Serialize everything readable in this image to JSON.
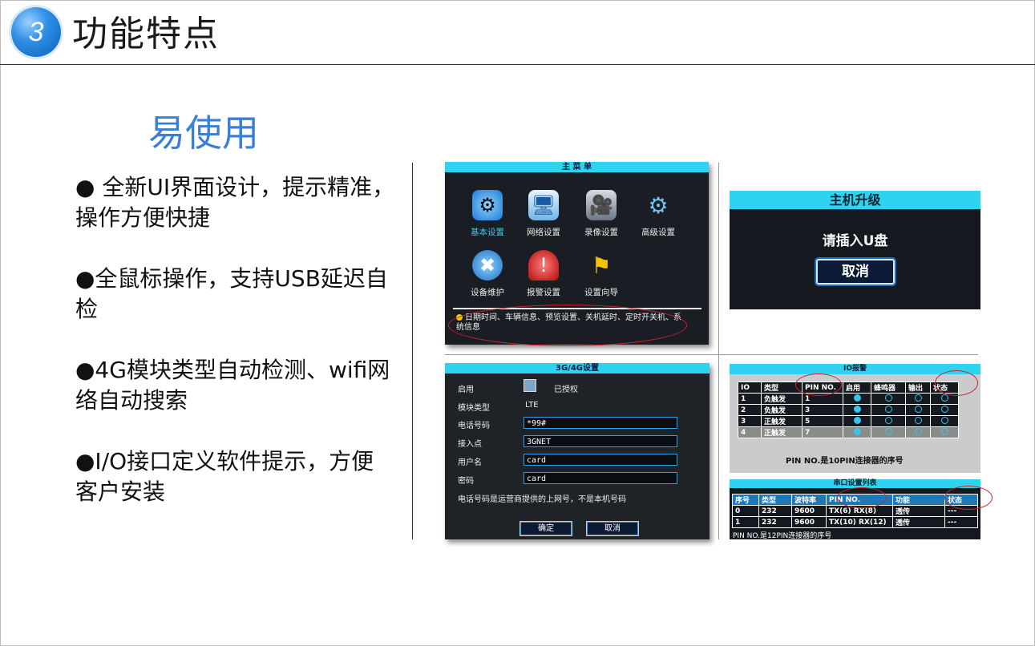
{
  "header": {
    "badge_number": "3",
    "title": "功能特点"
  },
  "subtitle": "易使用",
  "bullets": [
    "● 全新UI界面设计，提示精准，操作方便快捷",
    "●全鼠标操作，支持USB延迟自检",
    "●4G模块类型自动检测、wifi网络自动搜索",
    "●I/O接口定义软件提示，方便客户安装"
  ],
  "main_menu": {
    "title": "主 菜 单",
    "items": [
      {
        "label": "基本设置",
        "icon": "gear-icon"
      },
      {
        "label": "网络设置",
        "icon": "network-icon"
      },
      {
        "label": "录像设置",
        "icon": "camera-icon"
      },
      {
        "label": "高级设置",
        "icon": "gears-icon"
      },
      {
        "label": "设备维护",
        "icon": "tools-icon"
      },
      {
        "label": "报警设置",
        "icon": "alarm-icon"
      },
      {
        "label": "设置向导",
        "icon": "wizard-icon"
      }
    ],
    "description": "日期时间、车辆信息、预览设置、关机延时、定时开关机、系统信息"
  },
  "upgrade": {
    "title": "主机升级",
    "message": "请插入U盘",
    "cancel_label": "取消"
  },
  "net_settings": {
    "title": "3G/4G设置",
    "enable_label": "启用",
    "authorized_text": "已授权",
    "module_type_label": "模块类型",
    "module_type_value": "LTE",
    "phone_label": "电话号码",
    "phone_value": "*99#",
    "apn_label": "接入点",
    "apn_value": "3GNET",
    "user_label": "用户名",
    "user_value": "card",
    "password_label": "密码",
    "password_value": "card",
    "note": "电话号码是运营商提供的上网号，不是本机号码",
    "ok_label": "确定",
    "cancel_label": "取消"
  },
  "io_alarm": {
    "title": "IO报警",
    "columns": [
      "IO",
      "类型",
      "PIN NO.",
      "启用",
      "蜂鸣器",
      "输出",
      "状态"
    ],
    "rows": [
      {
        "io": "1",
        "type": "负触发",
        "pin": "1"
      },
      {
        "io": "2",
        "type": "负触发",
        "pin": "3"
      },
      {
        "io": "3",
        "type": "正触发",
        "pin": "5"
      },
      {
        "io": "4",
        "type": "正触发",
        "pin": "7"
      }
    ],
    "note": "PIN NO.是10PIN连接器的序号"
  },
  "serial": {
    "title": "串口设置列表",
    "columns": [
      "序号",
      "类型",
      "波特率",
      "PIN NO.",
      "功能",
      "状态"
    ],
    "rows": [
      {
        "no": "0",
        "type": "232",
        "baud": "9600",
        "pin": "TX(6) RX(8)",
        "func": "透传",
        "status": "---"
      },
      {
        "no": "1",
        "type": "232",
        "baud": "9600",
        "pin": "TX(10) RX(12)",
        "func": "透传",
        "status": "---"
      }
    ],
    "note": "PIN NO.是12PIN连接器的序号"
  }
}
